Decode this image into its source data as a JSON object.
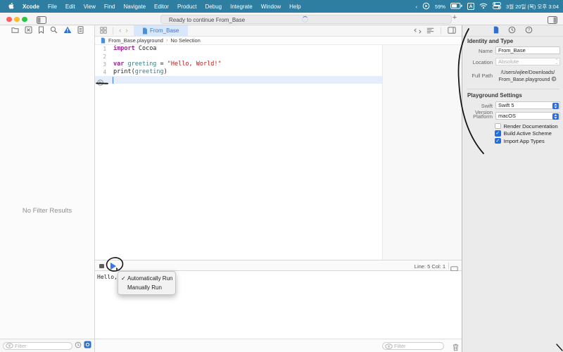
{
  "colors": {
    "menubar": "#2e7ea1",
    "accent": "#2f6fce",
    "tab_background": "#d9e7fa",
    "keyword": "#9b2393",
    "string": "#c41a16",
    "identifier": "#3e8087",
    "line_highlight": "#e7eefb",
    "checkbox_blue": "#1f6fe0"
  },
  "menubar": {
    "items": [
      "Xcode",
      "File",
      "Edit",
      "View",
      "Find",
      "Navigate",
      "Editor",
      "Product",
      "Debug",
      "Integrate",
      "Window",
      "Help"
    ],
    "status": {
      "chevron": "‹",
      "battery_percent": "59%",
      "input_source": "A",
      "clock": "3월 20일 (목) 오후 3:04"
    }
  },
  "toolbar": {
    "status_text": "Ready to continue From_Base",
    "add_button": "+"
  },
  "navigator": {
    "empty_text": "No Filter Results",
    "filter_placeholder": "Filter"
  },
  "editor": {
    "tab_label": "From_Base",
    "breadcrumb": {
      "file": "From_Base.playground",
      "separator": "›",
      "selection": "No Selection"
    },
    "code_lines": [
      {
        "num": "1",
        "segments": [
          {
            "style": "keyword",
            "text": "import"
          },
          {
            "style": "plain",
            "text": " Cocoa"
          }
        ]
      },
      {
        "num": "2",
        "segments": []
      },
      {
        "num": "3",
        "segments": [
          {
            "style": "keyword",
            "text": "var"
          },
          {
            "style": "plain",
            "text": " "
          },
          {
            "style": "ident",
            "text": "greeting"
          },
          {
            "style": "plain",
            "text": " = "
          },
          {
            "style": "string",
            "text": "\"Hello, World!\""
          }
        ]
      },
      {
        "num": "4",
        "segments": [
          {
            "style": "plain",
            "text": "print("
          },
          {
            "style": "ident",
            "text": "greeting"
          },
          {
            "style": "plain",
            "text": ")"
          }
        ]
      },
      {
        "num": "",
        "segments": []
      }
    ],
    "bottom_bar": {
      "line_col": "Line: 5 Col: 1"
    }
  },
  "console": {
    "output": "Hello,",
    "filter_placeholder": "Filter"
  },
  "popup": {
    "check_glyph": "✓",
    "items": [
      {
        "label": "Automatically Run",
        "checked": true
      },
      {
        "label": "Manually Run",
        "checked": false
      }
    ]
  },
  "inspector": {
    "identity_header": "Identity and Type",
    "name_label": "Name",
    "name_value": "From_Base",
    "location_label": "Location",
    "location_value": "Absolute",
    "fullpath_label": "Full Path",
    "fullpath_line1": "/Users/wjlee/Downloads/",
    "fullpath_line2": "From_Base.playground",
    "settings_header": "Playground Settings",
    "swift_label": "Swift Version",
    "swift_value": "Swift 5",
    "platform_label": "Platform",
    "platform_value": "macOS",
    "checkboxes": [
      {
        "label": "Render Documentation",
        "checked": false
      },
      {
        "label": "Build Active Scheme",
        "checked": true
      },
      {
        "label": "Import App Types",
        "checked": true
      }
    ]
  }
}
